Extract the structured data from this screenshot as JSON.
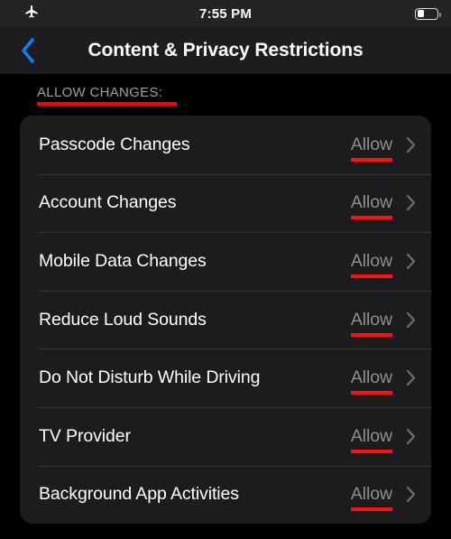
{
  "status_bar": {
    "airplane_icon": "airplane-icon",
    "time": "7:55 PM",
    "battery_icon": "battery-icon",
    "battery_level_percent": 30
  },
  "nav_bar": {
    "back_icon": "chevron-left-icon",
    "title": "Content & Privacy Restrictions",
    "back_accent_color": "#0a84ff"
  },
  "section": {
    "header": "ALLOW CHANGES:",
    "underline_color": "#ff0000"
  },
  "list": {
    "value_underline_color": "#ff1111",
    "chevron_icon": "chevron-right-icon",
    "rows": [
      {
        "label": "Passcode Changes",
        "value": "Allow"
      },
      {
        "label": "Account Changes",
        "value": "Allow"
      },
      {
        "label": "Mobile Data Changes",
        "value": "Allow"
      },
      {
        "label": "Reduce Loud Sounds",
        "value": "Allow"
      },
      {
        "label": "Do Not Disturb While Driving",
        "value": "Allow"
      },
      {
        "label": "TV Provider",
        "value": "Allow"
      },
      {
        "label": "Background App Activities",
        "value": "Allow"
      }
    ]
  }
}
